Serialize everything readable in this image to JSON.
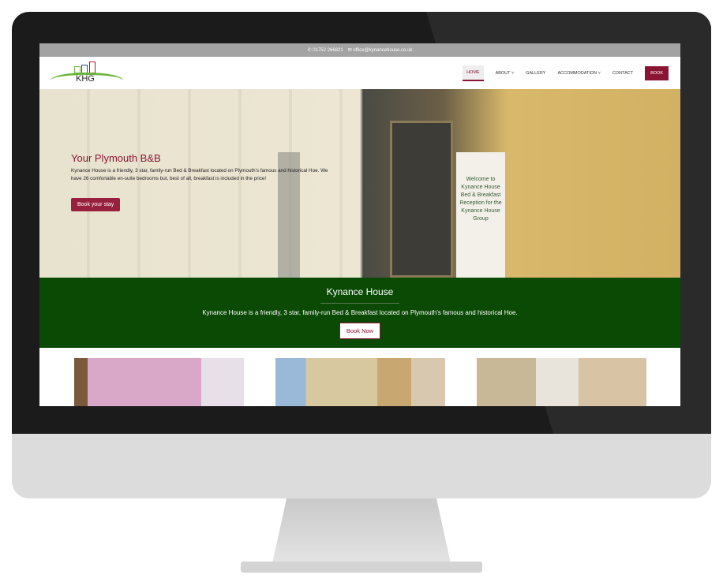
{
  "topbar": {
    "phone": "01752 266821",
    "email": "office@kynancehouse.co.uk"
  },
  "logo": {
    "text": "KHG"
  },
  "nav": [
    {
      "label": "HOME"
    },
    {
      "label": "ABOUT"
    },
    {
      "label": "GALLERY"
    },
    {
      "label": "ACCOMMODATION"
    },
    {
      "label": "CONTACT"
    },
    {
      "label": "BOOK"
    }
  ],
  "hero": {
    "title": "Your Plymouth B&B",
    "text": "Kynance House is a friendly, 3 star, family-run Bed & Breakfast located on Plymouth's famous and historical Hoe. We have 26 comfortable en-suite bedrooms but, best of all, breakfast is included in the price!",
    "button": "Book your stay",
    "sign": "Welcome to Kynance House Bed & Breakfast Reception for the Kynance House Group"
  },
  "intro": {
    "title": "Kynance House",
    "text": "Kynance House is a friendly, 3 star, family-run Bed & Breakfast located on Plymouth's famous and historical Hoe.",
    "button": "Book Now"
  },
  "colors": {
    "brand": "#8a1533",
    "green": "#0b4a05"
  }
}
